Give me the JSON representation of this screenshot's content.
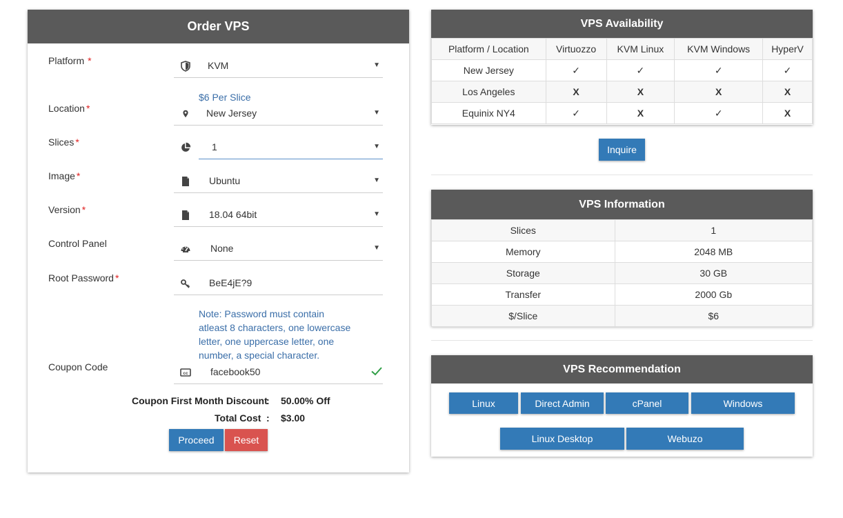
{
  "order": {
    "title": "Order VPS",
    "required_mark": "*",
    "fields": {
      "platform": {
        "label": "Platform",
        "value": "KVM",
        "icon": "shield-icon"
      },
      "platform_note": "$6 Per Slice",
      "location": {
        "label": "Location",
        "value": "New Jersey",
        "icon": "map-marker-icon"
      },
      "slices": {
        "label": "Slices",
        "value": "1",
        "icon": "pie-chart-icon"
      },
      "image": {
        "label": "Image",
        "value": "Ubuntu",
        "icon": "file-icon"
      },
      "version": {
        "label": "Version",
        "value": "18.04 64bit",
        "icon": "file-icon"
      },
      "control_panel": {
        "label": "Control Panel",
        "value": "None",
        "icon": "dashboard-icon"
      },
      "root_password": {
        "label": "Root Password",
        "value": "BeE4jE?9",
        "icon": "key-icon"
      },
      "password_note": [
        "Note: Password must contain",
        "atleast 8 characters, one lowercase",
        "letter, one uppercase letter, one",
        "number, a special character."
      ],
      "coupon": {
        "label": "Coupon Code",
        "value": "facebook50",
        "icon": "cc-icon"
      }
    },
    "summary": {
      "discount_label": "Coupon First Month Discount",
      "discount_value": "50.00% Off",
      "total_label": "Total Cost",
      "total_value": "$3.00",
      "separator": ":"
    },
    "buttons": {
      "proceed": "Proceed",
      "reset": "Reset"
    }
  },
  "availability": {
    "title": "VPS Availability",
    "headers": [
      "Platform / Location",
      "Virtuozzo",
      "KVM Linux",
      "KVM Windows",
      "HyperV"
    ],
    "rows": [
      {
        "location": "New Jersey",
        "cells": [
          "✓",
          "✓",
          "✓",
          "✓"
        ]
      },
      {
        "location": "Los Angeles",
        "cells": [
          "X",
          "X",
          "X",
          "X"
        ]
      },
      {
        "location": "Equinix NY4",
        "cells": [
          "✓",
          "X",
          "✓",
          "X"
        ]
      }
    ],
    "inquire_label": "Inquire"
  },
  "info": {
    "title": "VPS Information",
    "rows": [
      {
        "key": "Slices",
        "value": "1"
      },
      {
        "key": "Memory",
        "value": "2048 MB"
      },
      {
        "key": "Storage",
        "value": "30 GB"
      },
      {
        "key": "Transfer",
        "value": "2000 Gb"
      },
      {
        "key": "$/Slice",
        "value": "$6"
      }
    ]
  },
  "recommendation": {
    "title": "VPS Recommendation",
    "buttons": [
      "Linux",
      "Direct Admin",
      "cPanel",
      "Windows",
      "Linux Desktop",
      "Webuzo"
    ]
  },
  "colors": {
    "header_bg": "#5a5a5a",
    "primary": "#337ab7",
    "danger": "#d9534f",
    "ok": "#1a8a1a",
    "no": "#e01010",
    "note": "#3a6ea8"
  }
}
